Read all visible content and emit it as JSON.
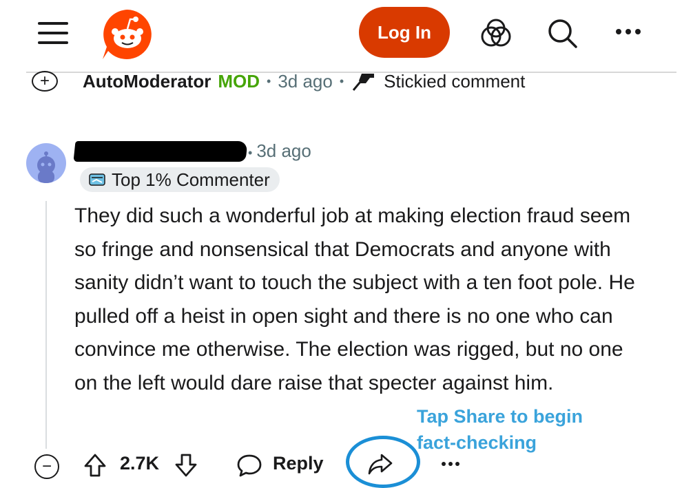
{
  "header": {
    "menu_icon": "hamburger-menu-icon",
    "logo_icon": "reddit-snoo-logo",
    "login_label": "Log In",
    "actions": [
      "communities-icon",
      "search-icon",
      "more-options-icon"
    ]
  },
  "sticky_comment": {
    "author": "AutoModerator",
    "badge": "MOD",
    "time": "3d ago",
    "pin_icon": "pin-icon",
    "status": "Stickied comment"
  },
  "comment": {
    "time": "3d ago",
    "flair": "Top 1% Commenter",
    "body": "They did such a wonderful job at making election fraud seem so fringe and nonsensical that Democrats and anyone with sanity didn’t want to touch the subject with a ten foot pole. He pulled off a heist in open sight and there is no one who can convince me otherwise. The election was rigged, but no one on the left would dare raise that specter against him.",
    "vote_count": "2.7K",
    "reply_label": "Reply"
  },
  "annotation": {
    "line1": "Tap Share to begin",
    "line2": "fact-checking"
  },
  "colors": {
    "login_bg": "#d93a00",
    "mod_green": "#46a508",
    "annotation_blue": "#3aa3db",
    "highlight_ring": "#1b8fd6"
  }
}
